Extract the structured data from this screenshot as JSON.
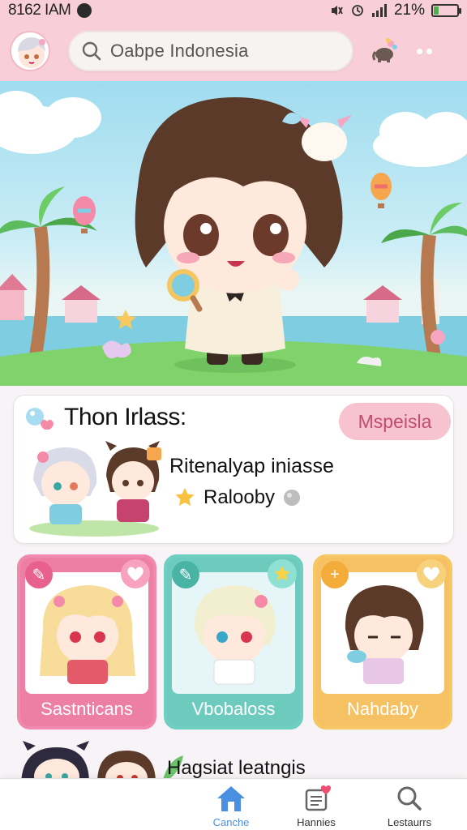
{
  "status_bar": {
    "time": "8162 IAM",
    "battery": "21%",
    "battery_level": 0.21
  },
  "header": {
    "search_placeholder": "Oabpe Indonesia",
    "icons": [
      "avatar",
      "search-icon",
      "elephant-icon",
      "more-icon"
    ]
  },
  "card": {
    "title": "Thon Irlass:",
    "pill_label": "Mspeisla",
    "line1": "Ritenalyap iniasse",
    "line2": "Ralooby"
  },
  "tiles": [
    {
      "label": "Sastnticans",
      "color": "#ed7ea4"
    },
    {
      "label": "Vbobaloss",
      "color": "#6ccbbd"
    },
    {
      "label": "Nahdaby",
      "color": "#f6c162"
    }
  ],
  "bottom_preview": {
    "label": "Hagsiat leatngis"
  },
  "nav": {
    "items": [
      {
        "label": "Canche",
        "icon": "home-icon",
        "active": true
      },
      {
        "label": "Hannies",
        "icon": "document-heart-icon",
        "active": false
      },
      {
        "label": "Lestaurrs",
        "icon": "search-icon",
        "active": false
      }
    ]
  },
  "colors": {
    "header_bg": "#f8cfd8",
    "accent_pink": "#f7c3d0",
    "nav_active": "#4a90e2"
  }
}
